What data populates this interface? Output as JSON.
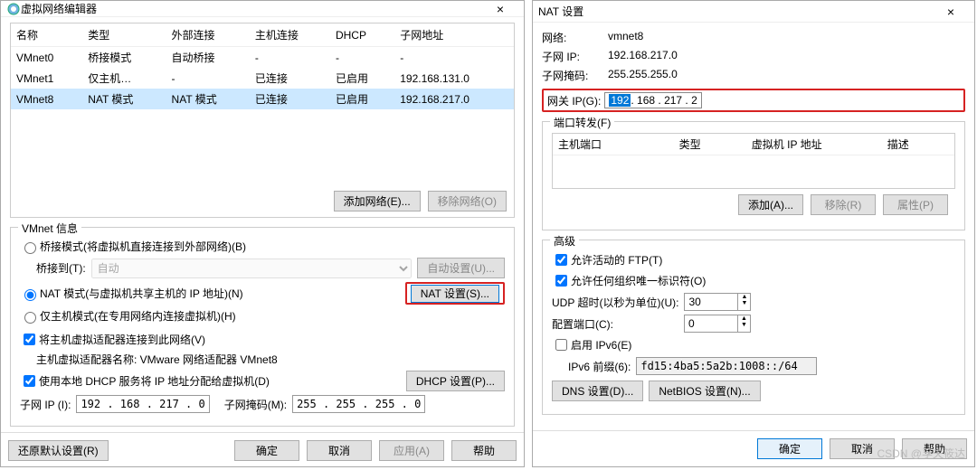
{
  "left": {
    "title": "虚拟网络编辑器",
    "columns": [
      "名称",
      "类型",
      "外部连接",
      "主机连接",
      "DHCP",
      "子网地址"
    ],
    "rows": [
      {
        "name": "VMnet0",
        "type": "桥接模式",
        "ext": "自动桥接",
        "host": "-",
        "dhcp": "-",
        "subnet": "-"
      },
      {
        "name": "VMnet1",
        "type": "仅主机…",
        "ext": "-",
        "host": "已连接",
        "dhcp": "已启用",
        "subnet": "192.168.131.0"
      },
      {
        "name": "VMnet8",
        "type": "NAT 模式",
        "ext": "NAT 模式",
        "host": "已连接",
        "dhcp": "已启用",
        "subnet": "192.168.217.0"
      }
    ],
    "addNet": "添加网络(E)...",
    "rmNet": "移除网络(O)",
    "group": "VMnet 信息",
    "bridge": "桥接模式(将虚拟机直接连接到外部网络)(B)",
    "bridgeTo": "桥接到(T):",
    "bridgeAuto": "自动",
    "autoSet": "自动设置(U)...",
    "nat": "NAT 模式(与虚拟机共享主机的 IP 地址)(N)",
    "natSet": "NAT 设置(S)...",
    "hostOnly": "仅主机模式(在专用网络内连接虚拟机)(H)",
    "connAdapter": "将主机虚拟适配器连接到此网络(V)",
    "adapterName": "主机虚拟适配器名称: VMware 网络适配器 VMnet8",
    "useDhcp": "使用本地 DHCP 服务将 IP 地址分配给虚拟机(D)",
    "dhcpSet": "DHCP 设置(P)...",
    "subnetIpL": "子网 IP (I):",
    "subnetIp": "192 . 168 . 217 .  0",
    "maskL": "子网掩码(M):",
    "mask": "255 . 255 . 255 .  0",
    "restore": "还原默认设置(R)",
    "ok": "确定",
    "cancel": "取消",
    "apply": "应用(A)",
    "help": "帮助"
  },
  "right": {
    "title": "NAT 设置",
    "netL": "网络:",
    "net": "vmnet8",
    "subL": "子网 IP:",
    "sub": "192.168.217.0",
    "mskL": "子网掩码:",
    "msk": "255.255.255.0",
    "gwL": "网关 IP(G):",
    "gw1": "192",
    "gw2": ". 168 . 217 .   2",
    "pfGroup": "端口转发(F)",
    "pfCols": [
      "主机端口",
      "类型",
      "虚拟机 IP 地址",
      "描述"
    ],
    "add": "添加(A)...",
    "rm": "移除(R)",
    "prop": "属性(P)",
    "advGroup": "高级",
    "ftp": "允许活动的 FTP(T)",
    "anyOrg": "允许任何组织唯一标识符(O)",
    "udpL": "UDP 超时(以秒为单位)(U):",
    "udp": "30",
    "cfgPortL": "配置端口(C):",
    "cfgPort": "0",
    "ipv6": "启用 IPv6(E)",
    "ipv6PreL": "IPv6 前缀(6):",
    "ipv6Pre": "fd15:4ba5:5a2b:1008::/64",
    "dns": "DNS 设置(D)...",
    "netbios": "NetBIOS 设置(N)...",
    "ok": "确定",
    "cancel": "取消",
    "help": "帮助",
    "watermark": "CSDN @孚夫筱达"
  }
}
